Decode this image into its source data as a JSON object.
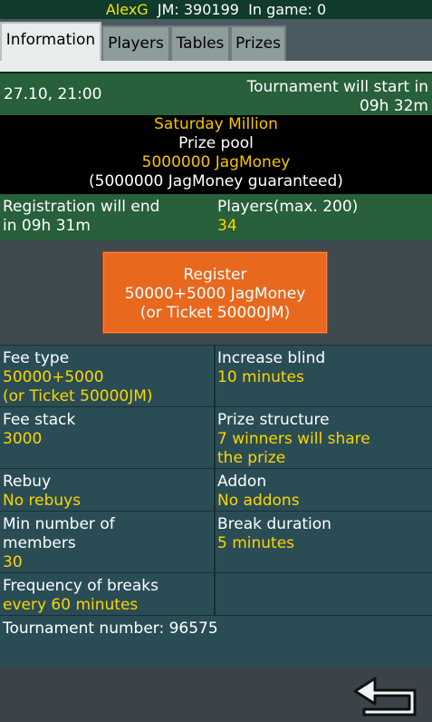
{
  "header": {
    "user": "AlexG",
    "jm_label": "JM:",
    "jm_value": "390199",
    "ingame_label": "In game:",
    "ingame_value": "0"
  },
  "tabs": [
    {
      "label": "Information",
      "active": true
    },
    {
      "label": "Players",
      "active": false
    },
    {
      "label": "Tables",
      "active": false
    },
    {
      "label": "Prizes",
      "active": false
    }
  ],
  "tournament": {
    "date": "27.10, 21:00",
    "start_line1": "Tournament will start in",
    "start_line2": "09h 32m",
    "name": "Saturday Million",
    "prize_pool_label": "Prize pool",
    "prize_pool": "5000000 JagMoney",
    "guaranteed": "(5000000 JagMoney guaranteed)",
    "registration_line1": "Registration will end",
    "registration_line2": "in 09h 31m",
    "players_label": "Players(max. 200)",
    "players_value": "34"
  },
  "register_button": {
    "line1": "Register",
    "line2": "50000+5000 JagMoney",
    "line3": "(or Ticket 50000JM)"
  },
  "details": {
    "fee_type_label": "Fee type",
    "fee_type_value1": "50000+5000",
    "fee_type_value2": "(or Ticket 50000JM)",
    "increase_blind_label": "Increase blind",
    "increase_blind_value": "10 minutes",
    "fee_stack_label": "Fee stack",
    "fee_stack_value": "3000",
    "prize_structure_label": "Prize structure",
    "prize_structure_value1": "7 winners will share",
    "prize_structure_value2": "the prize",
    "rebuy_label": "Rebuy",
    "rebuy_value": "No rebuys",
    "addon_label": "Addon",
    "addon_value": "No addons",
    "min_members_label1": "Min number of",
    "min_members_label2": "members",
    "min_members_value": "30",
    "break_duration_label": "Break duration",
    "break_duration_value": "5 minutes",
    "frequency_label": "Frequency of breaks",
    "frequency_value": "every 60 minutes",
    "tournament_number_label": "Tournament number:",
    "tournament_number_value": "96575"
  },
  "icons": {
    "back": "back-arrow-icon"
  },
  "colors": {
    "accent_yellow": "#f5c400",
    "register_orange": "#e8681e",
    "header_green": "#27603a"
  }
}
